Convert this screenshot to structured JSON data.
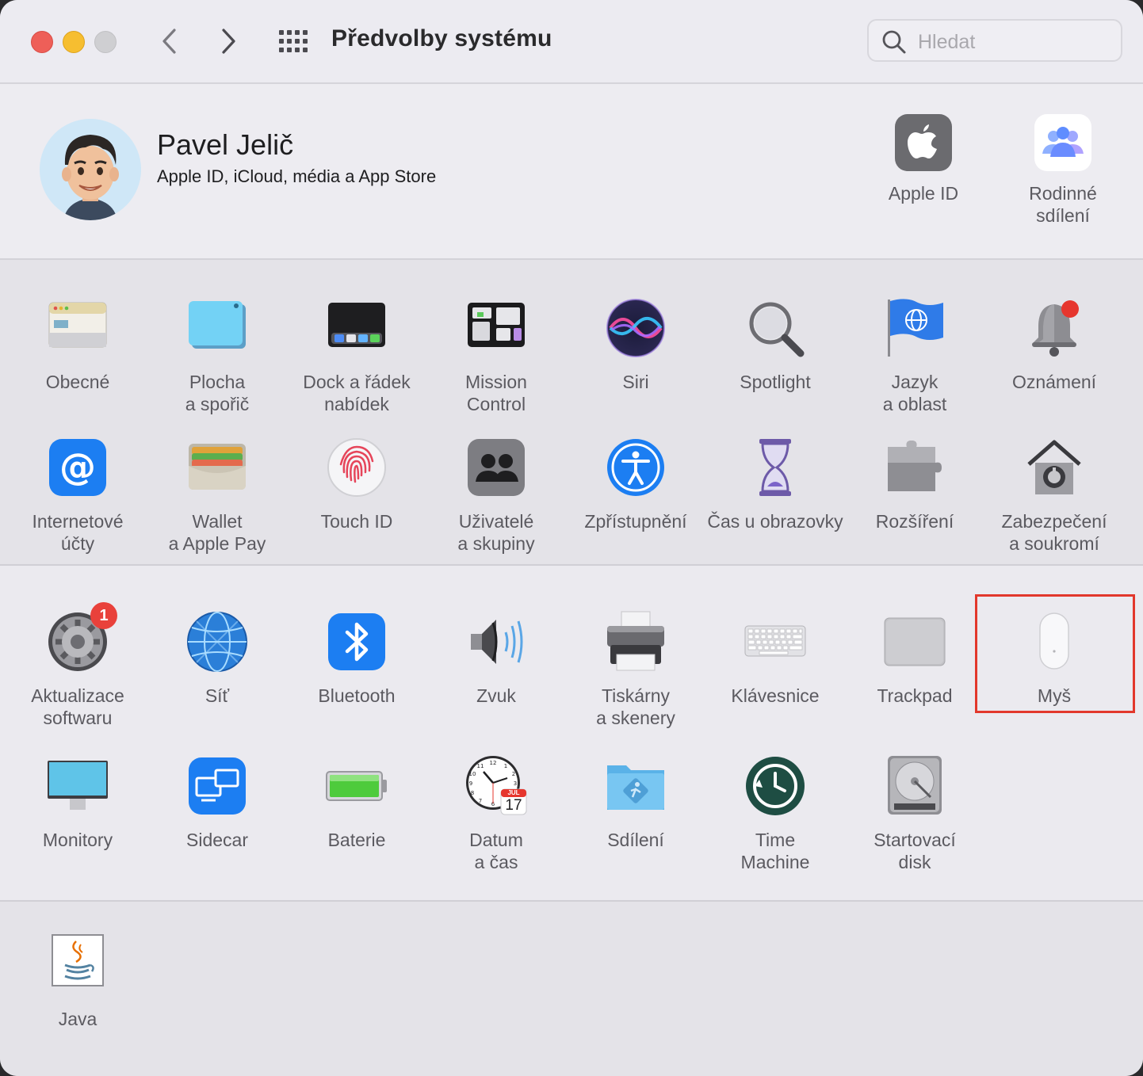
{
  "window": {
    "title": "Předvolby systému",
    "search_placeholder": "Hledat"
  },
  "user": {
    "name": "Pavel Jelič",
    "subtitle": "Apple ID, iCloud, média a App Store"
  },
  "top_panes": [
    {
      "label": "Apple ID",
      "icon": "apple-logo-icon"
    },
    {
      "label": "Rodinné\nsdílení",
      "icon": "family-sharing-icon"
    }
  ],
  "section1": [
    {
      "label": "Obecné",
      "icon": "general-icon"
    },
    {
      "label": "Plocha\na spořič",
      "icon": "desktop-icon"
    },
    {
      "label": "Dock a řádek\nnabídek",
      "icon": "dock-icon"
    },
    {
      "label": "Mission\nControl",
      "icon": "mission-control-icon"
    },
    {
      "label": "Siri",
      "icon": "siri-icon"
    },
    {
      "label": "Spotlight",
      "icon": "spotlight-icon"
    },
    {
      "label": "Jazyk\na oblast",
      "icon": "language-flag-icon"
    },
    {
      "label": "Oznámení",
      "icon": "notification-bell-icon"
    },
    {
      "label": "Internetové\núčty",
      "icon": "internet-accounts-icon"
    },
    {
      "label": "Wallet\na Apple Pay",
      "icon": "wallet-icon"
    },
    {
      "label": "Touch ID",
      "icon": "fingerprint-icon"
    },
    {
      "label": "Uživatelé\na skupiny",
      "icon": "users-groups-icon"
    },
    {
      "label": "Zpřístupnění",
      "icon": "accessibility-icon"
    },
    {
      "label": "Čas u obrazovky",
      "icon": "hourglass-icon"
    },
    {
      "label": "Rozšíření",
      "icon": "puzzle-icon"
    },
    {
      "label": "Zabezpečení\na soukromí",
      "icon": "security-house-icon"
    }
  ],
  "section2": [
    {
      "label": "Aktualizace\nsoftwaru",
      "icon": "software-update-gear-icon",
      "badge": "1"
    },
    {
      "label": "Síť",
      "icon": "network-globe-icon"
    },
    {
      "label": "Bluetooth",
      "icon": "bluetooth-icon"
    },
    {
      "label": "Zvuk",
      "icon": "speaker-icon"
    },
    {
      "label": "Tiskárny\na skenery",
      "icon": "printer-icon"
    },
    {
      "label": "Klávesnice",
      "icon": "keyboard-icon"
    },
    {
      "label": "Trackpad",
      "icon": "trackpad-icon"
    },
    {
      "label": "Myš",
      "icon": "mouse-icon"
    },
    {
      "label": "Monitory",
      "icon": "monitor-icon"
    },
    {
      "label": "Sidecar",
      "icon": "sidecar-icon"
    },
    {
      "label": "Baterie",
      "icon": "battery-icon"
    },
    {
      "label": "Datum\na čas",
      "icon": "date-time-clock-icon",
      "calendar_month": "JUL",
      "calendar_day": "17"
    },
    {
      "label": "Sdílení",
      "icon": "sharing-folder-icon"
    },
    {
      "label": "Time\nMachine",
      "icon": "time-machine-icon"
    },
    {
      "label": "Startovací\ndisk",
      "icon": "startup-disk-icon"
    }
  ],
  "section3": [
    {
      "label": "Java",
      "icon": "java-icon"
    }
  ]
}
